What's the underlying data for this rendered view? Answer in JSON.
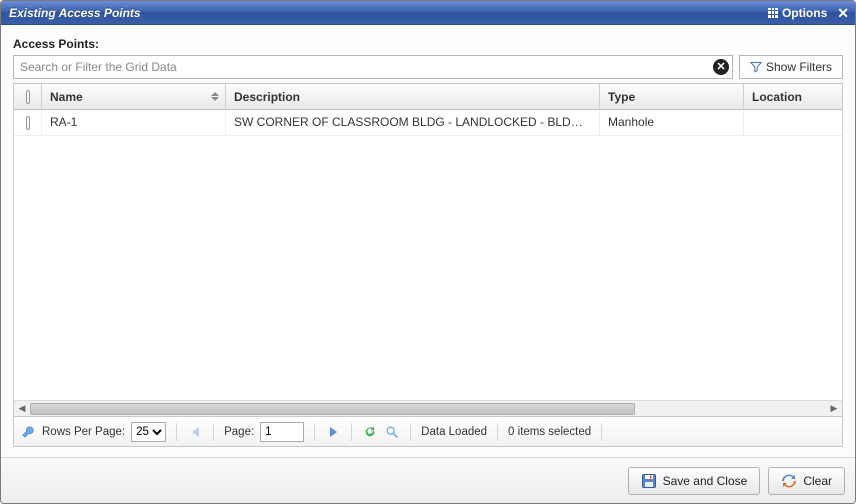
{
  "dialog": {
    "title": "Existing Access Points",
    "options_label": "Options",
    "close_tooltip": "Close"
  },
  "section": {
    "label": "Access Points:"
  },
  "search": {
    "placeholder": "Search or Filter the Grid Data",
    "value": ""
  },
  "filters": {
    "show_label": "Show Filters"
  },
  "grid": {
    "columns": {
      "name": "Name",
      "description": "Description",
      "type": "Type",
      "location": "Location"
    },
    "rows": [
      {
        "checked": false,
        "name": "RA-1",
        "description": "SW CORNER OF CLASSROOM BLDG - LANDLOCKED - BLDG BUIL...",
        "type": "Manhole",
        "location": ""
      }
    ]
  },
  "pager": {
    "rows_label": "Rows Per Page:",
    "rows_value": "25",
    "page_label": "Page:",
    "page_value": "1",
    "status": "Data Loaded",
    "selection": "0 items selected"
  },
  "buttons": {
    "save_close": "Save and Close",
    "clear": "Clear"
  }
}
